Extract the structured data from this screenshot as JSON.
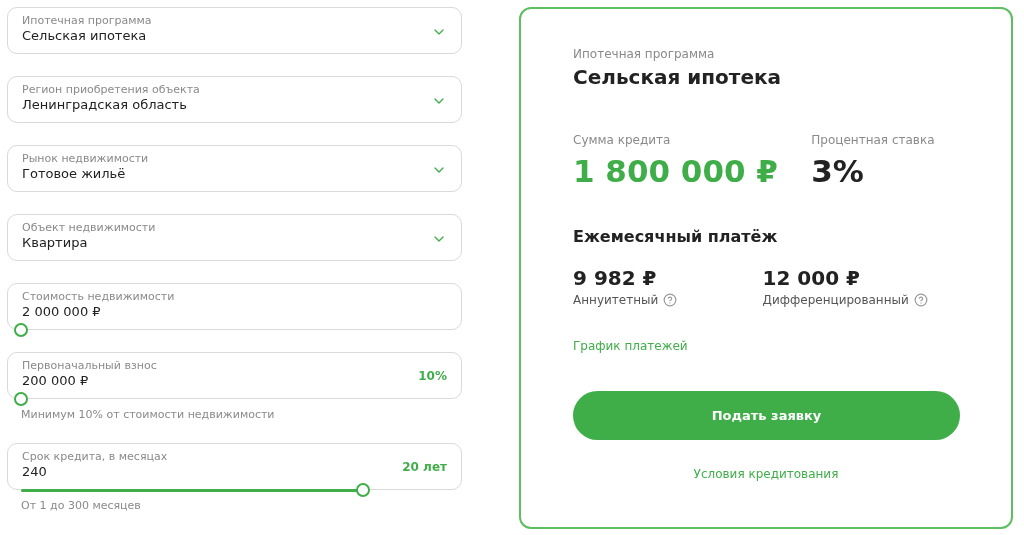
{
  "form": {
    "fields": [
      {
        "kind": "select",
        "label": "Ипотечная программа",
        "value": "Сельская ипотека"
      },
      {
        "kind": "select",
        "label": "Регион приобретения объекта",
        "value": "Ленинградская область"
      },
      {
        "kind": "select",
        "label": "Рынок недвижимости",
        "value": "Готовое жильё"
      },
      {
        "kind": "select",
        "label": "Объект недвижимости",
        "value": "Квартира"
      },
      {
        "kind": "slider",
        "label": "Стоимость недвижимости",
        "value": "2 000 000 ₽",
        "level": 0
      },
      {
        "kind": "slider",
        "label": "Первоначальный взнос",
        "value": "200 000 ₽",
        "badge": "10%",
        "level": 0,
        "hint": "Минимум 10% от стоимости недвижимости"
      },
      {
        "kind": "slider",
        "label": "Срок кредита, в месяцах",
        "value": "240",
        "badge": "20 лет",
        "level": 0.8,
        "hint": "От 1 до 300 месяцев"
      }
    ]
  },
  "summary": {
    "program_label": "Ипотечная программа",
    "program": "Сельская ипотека",
    "amount_label": "Сумма кредита",
    "amount": "1 800 000 ₽",
    "rate_label": "Процентная ставка",
    "rate": "3%",
    "monthly_heading": "Ежемесячный платёж",
    "payments": [
      {
        "amount": "9 982 ₽",
        "label": "Аннуитетный"
      },
      {
        "amount": "12 000 ₽",
        "label": "Дифференцированный"
      }
    ],
    "schedule_link": "График платежей",
    "apply_button": "Подать заявку",
    "terms_link": "Условия кредитования"
  }
}
